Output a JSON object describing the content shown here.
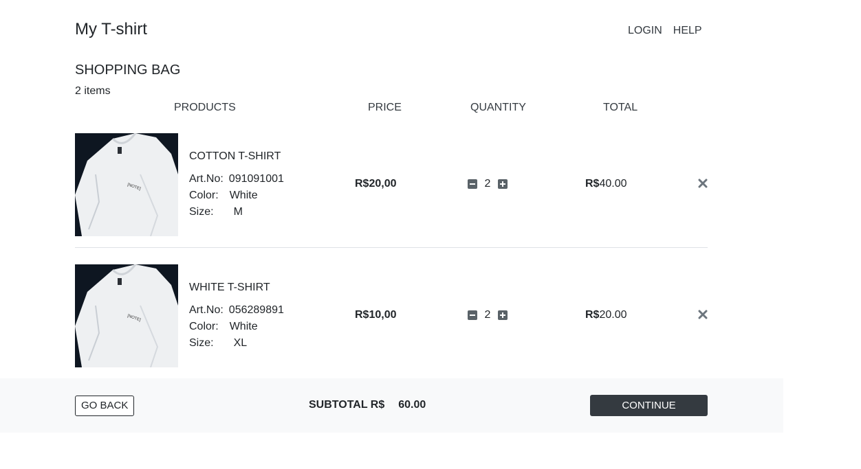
{
  "header": {
    "brand": "My T-shirt",
    "nav": {
      "login": "LOGIN",
      "help": "HELP"
    }
  },
  "bag": {
    "title": "SHOPPING BAG",
    "count": "2 items"
  },
  "columns": {
    "products": "PRODUCTS",
    "price": "PRICE",
    "quantity": "QUANTITY",
    "total": "TOTAL"
  },
  "items": [
    {
      "name": "COTTON T-SHIRT",
      "art_label": "Art.No:",
      "art_no": "091091001",
      "color_label": "Color:",
      "color": "White",
      "size_label": "Size:",
      "size": "M",
      "price": "R$20,00",
      "quantity": "2",
      "total_currency": "R$",
      "total_value": "40.00"
    },
    {
      "name": "WHITE T-SHIRT",
      "art_label": "Art.No:",
      "art_no": "056289891",
      "color_label": "Color:",
      "color": "White",
      "size_label": "Size:",
      "size": "XL",
      "price": "R$10,00",
      "quantity": "2",
      "total_currency": "R$",
      "total_value": "20.00"
    }
  ],
  "footer": {
    "back_label": "GO BACK",
    "subtotal_label": "SUBTOTAL R$",
    "subtotal_value": "60.00",
    "continue_label": "CONTINUE"
  },
  "icons": {
    "minus": "minus-square-icon",
    "plus": "plus-square-icon",
    "remove": "close-icon"
  },
  "colors": {
    "dark_button": "#343a40",
    "footer_bg": "#f8f9fa",
    "qty_button": "#5a6268"
  }
}
